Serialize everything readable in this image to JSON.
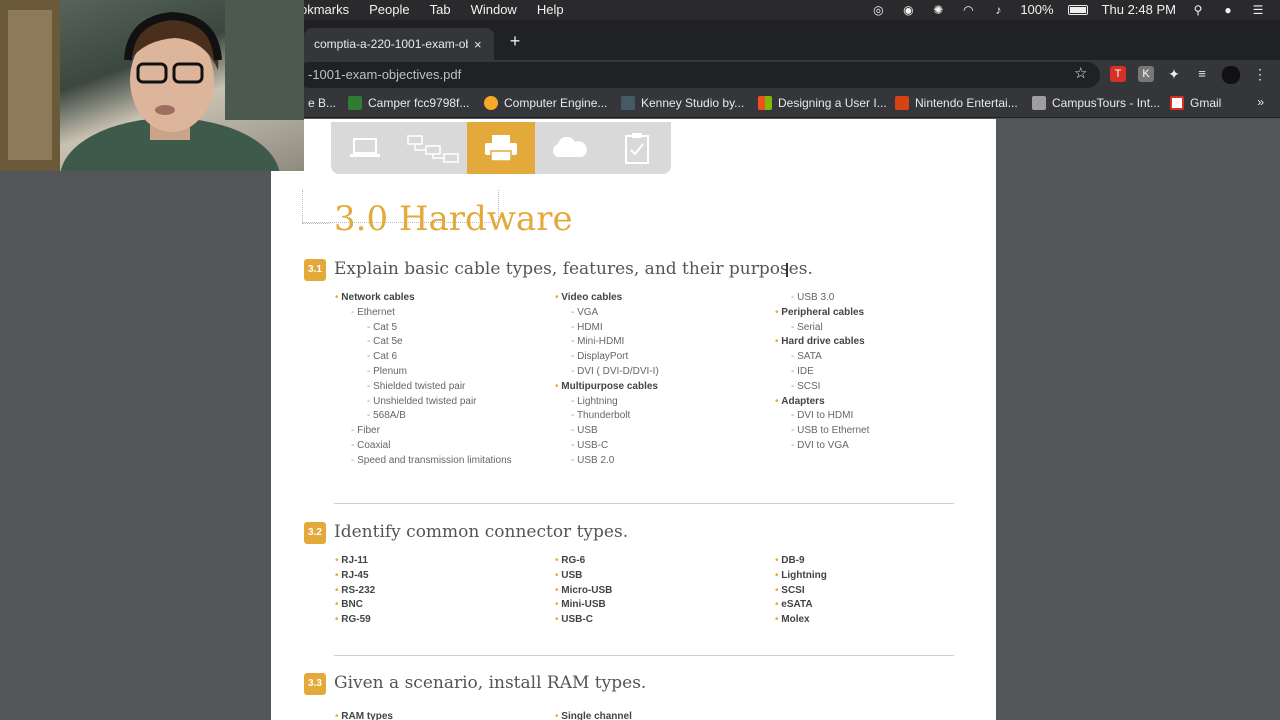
{
  "menubar": {
    "menus": [
      "okmarks",
      "People",
      "Tab",
      "Window",
      "Help"
    ],
    "battery": "100%",
    "clock": "Thu 2:48 PM"
  },
  "tab": {
    "title": "comptia-a-220-1001-exam-ob",
    "close": "×",
    "new": "+"
  },
  "omnibox": {
    "url": "-1001-exam-objectives.pdf"
  },
  "bookmarks": [
    {
      "label": "e B...",
      "color": "#4a4a4a"
    },
    {
      "label": "Camper fcc9798f...",
      "color": "#2e7d32"
    },
    {
      "label": "Computer Engine...",
      "color": "#f9a825"
    },
    {
      "label": "Kenney Studio by...",
      "color": "#455a64"
    },
    {
      "label": "Designing a User I...",
      "color": "#1976d2"
    },
    {
      "label": "Nintendo Entertai...",
      "color": "#d84315"
    },
    {
      "label": "CampusTours - Int...",
      "color": "#9e9e9e"
    },
    {
      "label": "Gmail",
      "color": "#d93025"
    }
  ],
  "bookmarks_more": "»",
  "doc": {
    "title": "3.0 Hardware",
    "sections": [
      {
        "badge": "3.1",
        "title": "Explain basic cable types, features, and their purposes.",
        "col1": [
          {
            "t": "Network cables",
            "lvl": 0
          },
          {
            "t": "Ethernet",
            "lvl": 1
          },
          {
            "t": "Cat 5",
            "lvl": 2
          },
          {
            "t": "Cat 5e",
            "lvl": 2
          },
          {
            "t": "Cat 6",
            "lvl": 2
          },
          {
            "t": "Plenum",
            "lvl": 2
          },
          {
            "t": "Shielded twisted pair",
            "lvl": 2
          },
          {
            "t": "Unshielded twisted pair",
            "lvl": 2
          },
          {
            "t": "568A/B",
            "lvl": 2
          },
          {
            "t": "Fiber",
            "lvl": 1
          },
          {
            "t": "Coaxial",
            "lvl": 1
          },
          {
            "t": "Speed and transmission limitations",
            "lvl": 1
          }
        ],
        "col2": [
          {
            "t": "Video cables",
            "lvl": 0
          },
          {
            "t": "VGA",
            "lvl": 1
          },
          {
            "t": "HDMI",
            "lvl": 1
          },
          {
            "t": "Mini-HDMI",
            "lvl": 1
          },
          {
            "t": "DisplayPort",
            "lvl": 1
          },
          {
            "t": "DVI ( DVI-D/DVI-I)",
            "lvl": 1
          },
          {
            "t": "Multipurpose cables",
            "lvl": 0
          },
          {
            "t": "Lightning",
            "lvl": 1
          },
          {
            "t": "Thunderbolt",
            "lvl": 1
          },
          {
            "t": "USB",
            "lvl": 1
          },
          {
            "t": "USB-C",
            "lvl": 1
          },
          {
            "t": "USB 2.0",
            "lvl": 1
          }
        ],
        "col3": [
          {
            "t": "USB 3.0",
            "lvl": 1
          },
          {
            "t": "Peripheral cables",
            "lvl": 0
          },
          {
            "t": "Serial",
            "lvl": 1
          },
          {
            "t": "Hard drive cables",
            "lvl": 0
          },
          {
            "t": "SATA",
            "lvl": 1
          },
          {
            "t": "IDE",
            "lvl": 1
          },
          {
            "t": "SCSI",
            "lvl": 1
          },
          {
            "t": "Adapters",
            "lvl": 0
          },
          {
            "t": "DVI to HDMI",
            "lvl": 1
          },
          {
            "t": "USB to Ethernet",
            "lvl": 1
          },
          {
            "t": "DVI to VGA",
            "lvl": 1
          }
        ]
      },
      {
        "badge": "3.2",
        "title": "Identify common connector types.",
        "col1": [
          {
            "t": "RJ-11",
            "lvl": 0
          },
          {
            "t": "RJ-45",
            "lvl": 0
          },
          {
            "t": "RS-232",
            "lvl": 0
          },
          {
            "t": "BNC",
            "lvl": 0
          },
          {
            "t": "RG-59",
            "lvl": 0
          }
        ],
        "col2": [
          {
            "t": "RG-6",
            "lvl": 0
          },
          {
            "t": "USB",
            "lvl": 0
          },
          {
            "t": "Micro-USB",
            "lvl": 0
          },
          {
            "t": "Mini-USB",
            "lvl": 0
          },
          {
            "t": "USB-C",
            "lvl": 0
          }
        ],
        "col3": [
          {
            "t": "DB-9",
            "lvl": 0
          },
          {
            "t": "Lightning",
            "lvl": 0
          },
          {
            "t": "SCSI",
            "lvl": 0
          },
          {
            "t": "eSATA",
            "lvl": 0
          },
          {
            "t": "Molex",
            "lvl": 0
          }
        ]
      },
      {
        "badge": "3.3",
        "title": "Given a scenario, install RAM types.",
        "col1": [
          {
            "t": "RAM types",
            "lvl": 0
          }
        ],
        "col2": [
          {
            "t": "Single channel",
            "lvl": 0
          }
        ],
        "col3": []
      }
    ]
  },
  "colors": {
    "accent": "#e4a93b",
    "chrome_dark": "#202124",
    "chrome_mid": "#35363a"
  }
}
